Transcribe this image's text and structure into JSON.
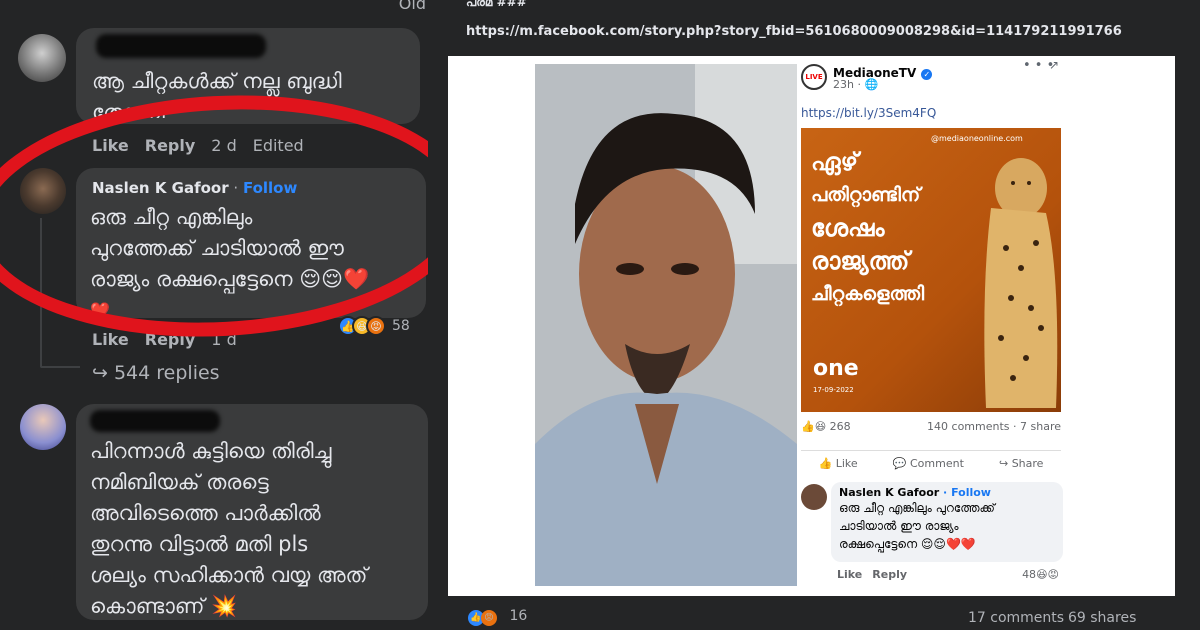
{
  "left": {
    "top_text": "Old",
    "comment1": {
      "text": "ആ ചീറ്റകൾക്ക് നല്ല ബുദ്ധി തോന്നി",
      "actions": {
        "like": "Like",
        "reply": "Reply",
        "time": "2 d",
        "edited": "Edited"
      }
    },
    "comment2": {
      "name": "Naslen K Gafoor",
      "sep": " · ",
      "follow": "Follow",
      "text_line1": "ഒരു ചീറ്റ എങ്കിലും",
      "text_line2": "പുറത്തേക്ക് ചാടിയാൽ ഈ",
      "text_line3": "രാജ്യം രക്ഷപ്പെട്ടേനെ 😌😌❤️",
      "text_line4": "❤️",
      "actions": {
        "like": "Like",
        "reply": "Reply",
        "time": "1 d"
      },
      "reactions_count": "58",
      "replies": "544 replies"
    },
    "comment3": {
      "line1": "പിറന്നാൾ കുട്ടിയെ തിരിച്ചു",
      "line2": "നമിബിയക് തരട്ടെ",
      "line3": "അവിടെത്തെ പാർക്കിൽ",
      "line4": "തുറന്നു വിട്ടാൽ മതി pls",
      "line5": "ശല്യം സഹിക്കാൻ വയ്യ അത്",
      "line6": "കൊണ്ടാണ് 💥"
    }
  },
  "right": {
    "header_partial": "പരമ ###",
    "url": "https://m.facebook.com/story.php?story_fbid=5610680009008298&id=114179211991766",
    "post": {
      "page_name": "MediaoneTV",
      "time": "23h · ",
      "link": "https://bit.ly/3Sem4FQ",
      "poster_lines": [
        "ഏഴ്",
        "പതിറ്റാണ്ടിന്",
        "ശേഷം",
        "രാജ്യത്ത്",
        "ചീറ്റകളെത്തി"
      ],
      "poster_site": "@mediaoneonline.com",
      "poster_brand": "one",
      "poster_date": "17-09-2022",
      "reactions_count": "268",
      "comments_shares": "140 comments · 7 share",
      "like": "Like",
      "comment": "Comment",
      "share": "Share",
      "comment_name": "Naslen K Gafoor",
      "comment_follow": "Follow",
      "comment_line1": "ഒരു ചീറ്റ എങ്കിലും പുറത്തേക്ക്",
      "comment_line2": "ചാടിയാൽ ഈ രാജ്യം",
      "comment_line3": "രക്ഷപ്പെട്ടേനെ 😌😌❤️❤️",
      "c_like": "Like",
      "c_reply": "Reply",
      "c_reacts": "48"
    },
    "footer": {
      "reactions": "16",
      "comments": "17 comments",
      "shares": "69 shares"
    }
  }
}
